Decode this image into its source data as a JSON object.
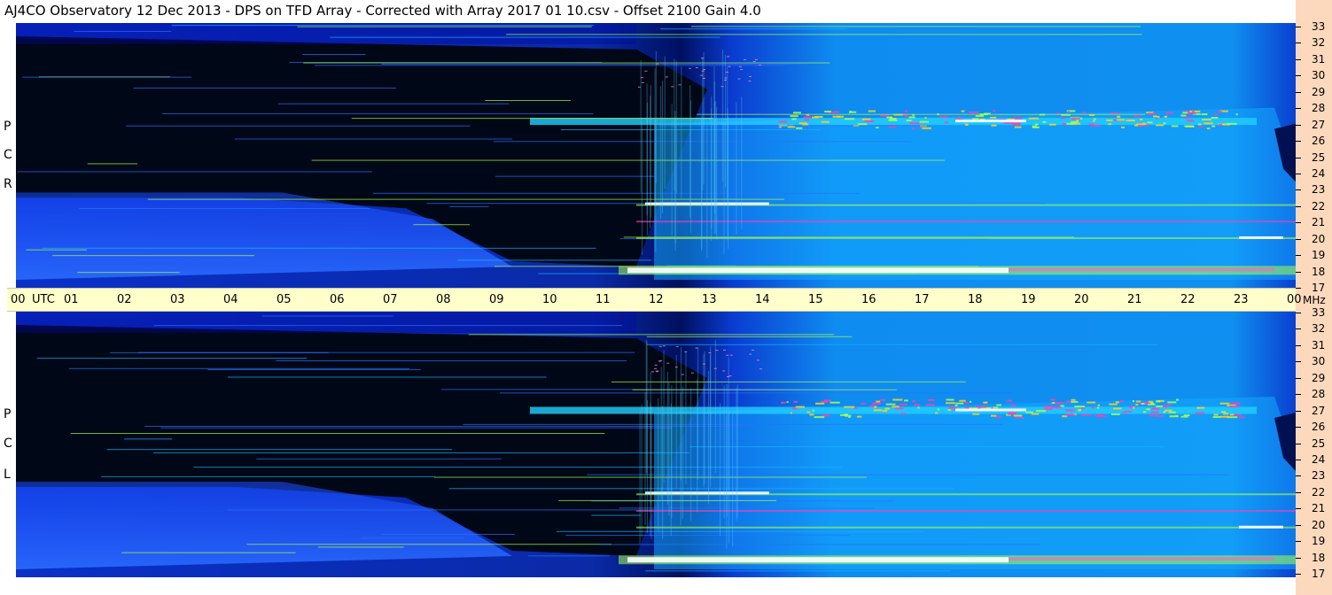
{
  "title": "AJ4CO Observatory  12 Dec 2013  -  DPS on TFD Array  -  Corrected with Array 2017 01 10.csv  -  Offset 2100  Gain 4.0",
  "chart_data": {
    "type": "heatmap",
    "xlabel": "UTC",
    "ylabel": "MHz",
    "x_ticks": [
      "00",
      "01",
      "02",
      "03",
      "04",
      "05",
      "06",
      "07",
      "08",
      "09",
      "10",
      "11",
      "12",
      "13",
      "14",
      "15",
      "16",
      "17",
      "18",
      "19",
      "20",
      "21",
      "22",
      "23",
      "00"
    ],
    "y_ticks": [
      "33",
      "32",
      "31",
      "30",
      "29",
      "28",
      "27",
      "26",
      "25",
      "24",
      "23",
      "22",
      "21",
      "20",
      "19",
      "18",
      "17"
    ],
    "ylim": [
      17,
      33
    ],
    "panels": [
      {
        "name": "RCP",
        "label_chars": [
          "P",
          "C",
          "R"
        ]
      },
      {
        "name": "LCP",
        "label_chars": [
          "P",
          "C",
          "L"
        ]
      }
    ],
    "utc_label": "UTC",
    "unit_label": "MHz",
    "colors": {
      "background": "#000820",
      "low": "#0a2ac0",
      "mid": "#13b4ff",
      "high": "#a8ff4c",
      "peak": "#ff40b0",
      "max": "#ffffff"
    }
  }
}
